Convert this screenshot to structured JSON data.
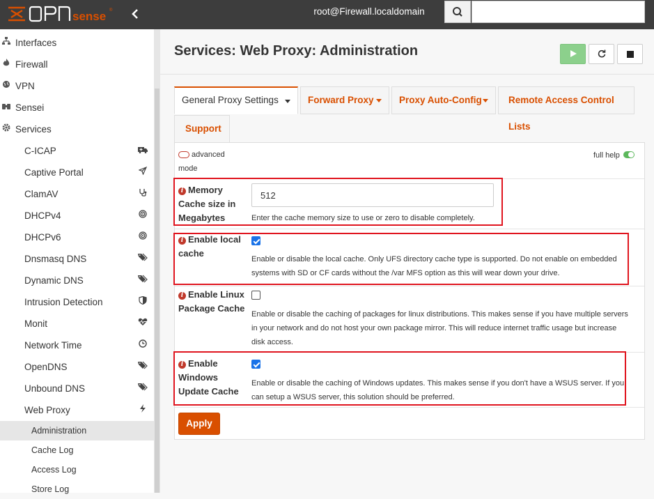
{
  "header": {
    "logo_text": "OPNsense",
    "user": "root@Firewall.localdomain"
  },
  "sidebar": {
    "sections": [
      {
        "label": "Interfaces",
        "icon": "sitemap-icon"
      },
      {
        "label": "Firewall",
        "icon": "fire-icon"
      },
      {
        "label": "VPN",
        "icon": "globe-icon"
      },
      {
        "label": "Sensei",
        "icon": "binoculars-icon"
      },
      {
        "label": "Services",
        "icon": "gears-icon"
      }
    ],
    "services_items": [
      {
        "label": "C-ICAP",
        "icon": "ambulance-icon"
      },
      {
        "label": "Captive Portal",
        "icon": "paper-plane-icon"
      },
      {
        "label": "ClamAV",
        "icon": "stethoscope-icon"
      },
      {
        "label": "DHCPv4",
        "icon": "bullseye-icon"
      },
      {
        "label": "DHCPv6",
        "icon": "bullseye-icon"
      },
      {
        "label": "Dnsmasq DNS",
        "icon": "tags-icon"
      },
      {
        "label": "Dynamic DNS",
        "icon": "tags-icon"
      },
      {
        "label": "Intrusion Detection",
        "icon": "shield-icon"
      },
      {
        "label": "Monit",
        "icon": "heartbeat-icon"
      },
      {
        "label": "Network Time",
        "icon": "clock-icon"
      },
      {
        "label": "OpenDNS",
        "icon": "tags-icon"
      },
      {
        "label": "Unbound DNS",
        "icon": "tags-icon"
      },
      {
        "label": "Web Proxy",
        "icon": "bolt-icon"
      }
    ],
    "webproxy_items": [
      {
        "label": "Administration",
        "active": true
      },
      {
        "label": "Cache Log",
        "active": false
      },
      {
        "label": "Access Log",
        "active": false
      },
      {
        "label": "Store Log",
        "active": false
      }
    ]
  },
  "page": {
    "title": "Services: Web Proxy: Administration"
  },
  "tabs": [
    {
      "label": "General Proxy Settings",
      "active": true,
      "dropdown": true
    },
    {
      "label": "Forward Proxy",
      "active": false,
      "dropdown": true
    },
    {
      "label": "Proxy Auto-Config",
      "active": false,
      "dropdown": true
    },
    {
      "label": "Remote Access Control Lists",
      "active": false,
      "dropdown": false
    },
    {
      "label": "Support",
      "active": false,
      "dropdown": false
    }
  ],
  "form": {
    "advanced_mode_label": "advanced mode",
    "full_help_label": "full help",
    "fields": [
      {
        "label": "Memory Cache size in Megabytes",
        "value": "512",
        "help": "Enter the cache memory size to use or zero to disable completely."
      },
      {
        "label": "Enable local cache",
        "checked": true,
        "help": "Enable or disable the local cache. Only UFS directory cache type is supported. Do not enable on embedded systems with SD or CF cards without the /var MFS option as this will wear down your drive."
      },
      {
        "label": "Enable Linux Package Cache",
        "checked": false,
        "help": "Enable or disable the caching of packages for linux distributions. This makes sense if you have multiple servers in your network and do not host your own package mirror. This will reduce internet traffic usage but increase disk access."
      },
      {
        "label": "Enable Windows Update Cache",
        "checked": true,
        "help": "Enable or disable the caching of Windows updates. This makes sense if you don't have a WSUS server. If you can setup a WSUS server, this solution should be preferred."
      }
    ],
    "apply_label": "Apply"
  },
  "colors": {
    "brand": "#d94f00",
    "topbar": "#3d3d3d",
    "highlight_box": "#e0141e",
    "checkbox_checked": "#1a73e8",
    "start_button": "#8cd08c"
  }
}
